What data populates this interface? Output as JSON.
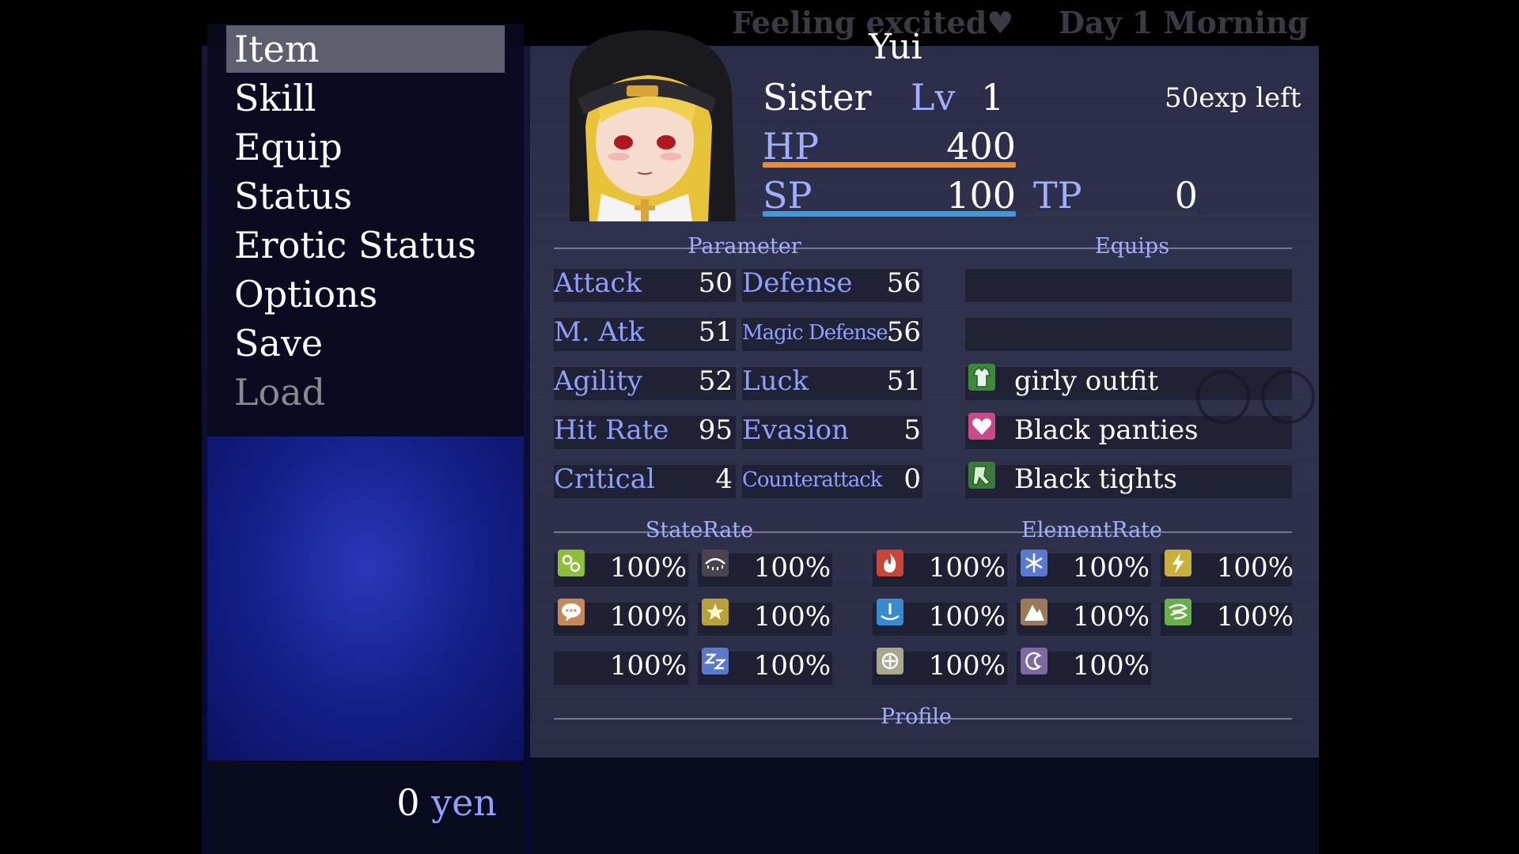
{
  "top": {
    "mood": "Feeling excited♥",
    "day": "Day 1 Morning"
  },
  "menu": {
    "items": [
      {
        "label": "Item"
      },
      {
        "label": "Skill"
      },
      {
        "label": "Equip"
      },
      {
        "label": "Status"
      },
      {
        "label": "Erotic Status"
      },
      {
        "label": "Options"
      },
      {
        "label": "Save"
      },
      {
        "label": "Load"
      }
    ],
    "selected": "Item"
  },
  "gold": {
    "amount": "0",
    "unit": "yen"
  },
  "actor": {
    "name": "Yui",
    "class": "Sister",
    "lv_label": "Lv",
    "level": "1",
    "exp_left": "50exp left",
    "hp_label": "HP",
    "hp": "400",
    "sp_label": "SP",
    "sp": "100",
    "tp_label": "TP",
    "tp": "0",
    "hp_fill": 1.0,
    "sp_fill": 1.0,
    "tp_fill": 0.0
  },
  "headers": {
    "parameter": "Parameter",
    "equips": "Equips",
    "state_rate": "StateRate",
    "element_rate": "ElementRate",
    "profile": "Profile"
  },
  "params": [
    {
      "l1": "Attack",
      "v1": "50",
      "l2": "Defense",
      "v2": "56"
    },
    {
      "l1": "M. Atk",
      "v1": "51",
      "l2": "Magic Defense",
      "v2": "56"
    },
    {
      "l1": "Agility",
      "v1": "52",
      "l2": "Luck",
      "v2": "51"
    },
    {
      "l1": "Hit Rate",
      "v1": "95",
      "l2": "Evasion",
      "v2": "5"
    },
    {
      "l1": "Critical",
      "v1": "4",
      "l2": "Counterattack",
      "v2": "0"
    }
  ],
  "equips": [
    {
      "name": "",
      "icon": ""
    },
    {
      "name": "",
      "icon": ""
    },
    {
      "name": "girly outfit",
      "icon": "outfit-icon"
    },
    {
      "name": "Black panties",
      "icon": "heart-icon"
    },
    {
      "name": "Black tights",
      "icon": "tights-icon"
    }
  ],
  "state_rates": [
    {
      "icon": "poison-icon",
      "value": "100%",
      "color": "#8fbf3a"
    },
    {
      "icon": "blind-icon",
      "value": "100%",
      "color": "#4a4450"
    },
    {
      "icon": "silence-icon",
      "value": "100%",
      "color": "#c48a5a"
    },
    {
      "icon": "confuse-icon",
      "value": "100%",
      "color": "#b8a03a"
    },
    {
      "icon": "",
      "value": "100%",
      "color": ""
    },
    {
      "icon": "sleep-icon",
      "value": "100%",
      "color": "#5a7ac8"
    }
  ],
  "element_rates": [
    {
      "icon": "fire-icon",
      "value": "100%",
      "color": "#c8453a"
    },
    {
      "icon": "ice-icon",
      "value": "100%",
      "color": "#5a7ad0"
    },
    {
      "icon": "thunder-icon",
      "value": "100%",
      "color": "#c8b03a"
    },
    {
      "icon": "water-icon",
      "value": "100%",
      "color": "#3a8ad0"
    },
    {
      "icon": "earth-icon",
      "value": "100%",
      "color": "#9a7a5a"
    },
    {
      "icon": "wind-icon",
      "value": "100%",
      "color": "#6ab04a"
    },
    {
      "icon": "holy-icon",
      "value": "100%",
      "color": "#a8a890"
    },
    {
      "icon": "dark-icon",
      "value": "100%",
      "color": "#7a6aa0"
    }
  ],
  "colors": {
    "hp_bar": "#f08a2a",
    "sp_bar": "#3a9ae0",
    "system": "#8ea0ff"
  }
}
